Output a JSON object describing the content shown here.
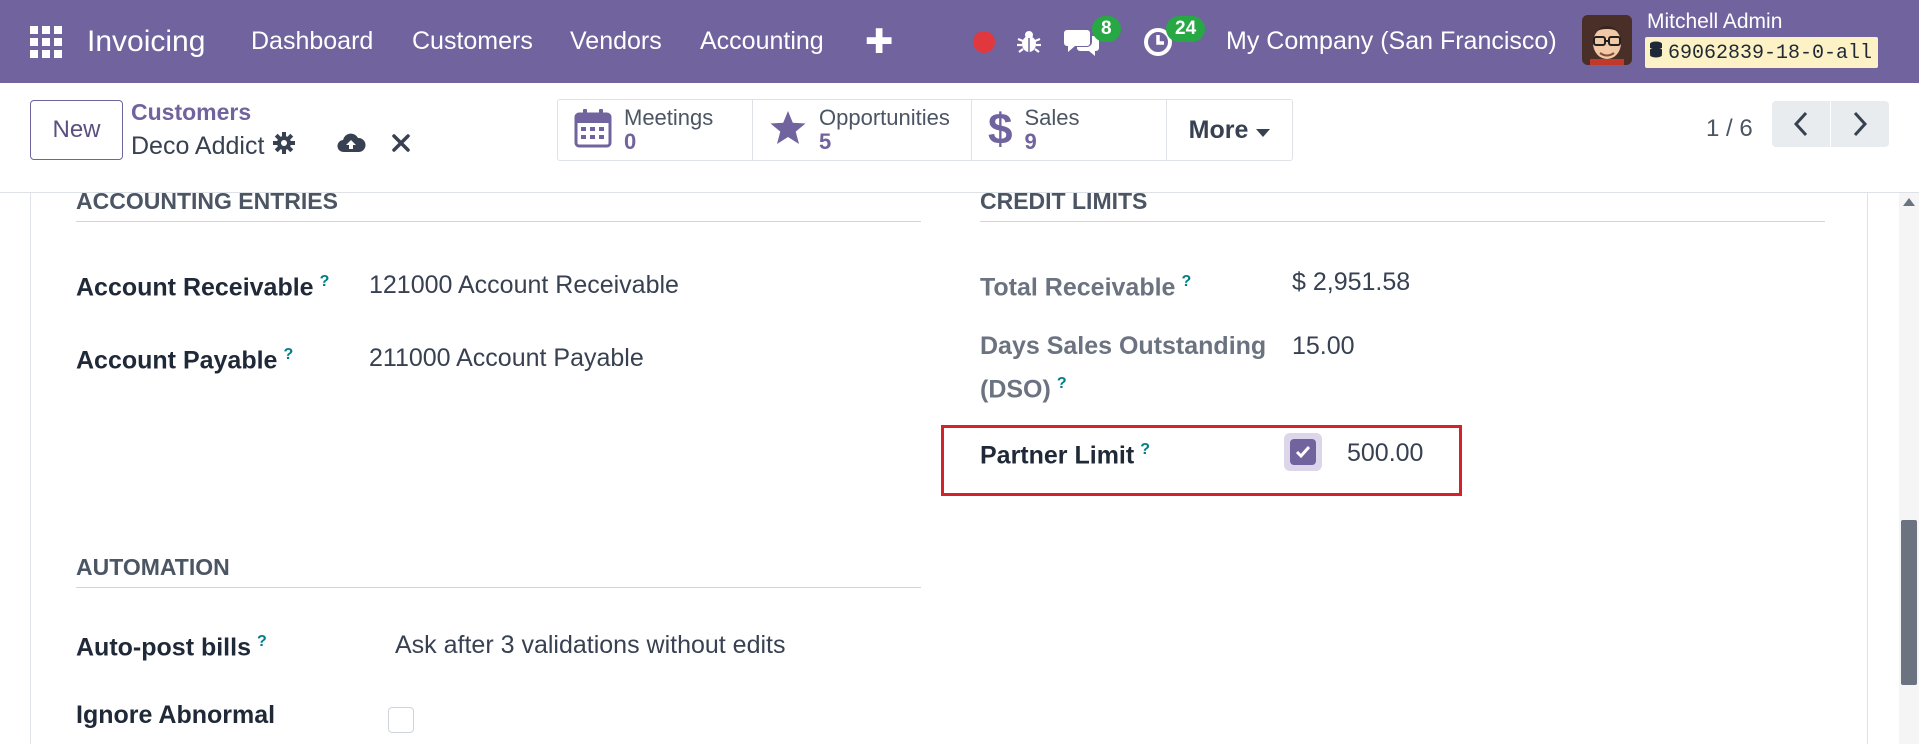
{
  "navbar": {
    "brand": "Invoicing",
    "menu": [
      "Dashboard",
      "Customers",
      "Vendors",
      "Accounting"
    ],
    "chat_count": "8",
    "activity_count": "24",
    "company": "My Company (San Francisco)",
    "user_name": "Mitchell Admin",
    "database": "69062839-18-0-all"
  },
  "control": {
    "new_label": "New",
    "breadcrumb_parent": "Customers",
    "record_name": "Deco Addict",
    "smart_buttons": [
      {
        "label": "Meetings",
        "value": "0",
        "icon": "calendar-icon"
      },
      {
        "label": "Opportunities",
        "value": "5",
        "icon": "star-icon"
      },
      {
        "label": "Sales",
        "value": "9",
        "icon": "dollar-icon"
      }
    ],
    "more_label": "More",
    "pager": "1 / 6"
  },
  "accounting_entries": {
    "title": "ACCOUNTING ENTRIES",
    "receivable_label": "Account Receivable",
    "receivable_value": "121000 Account Receivable",
    "payable_label": "Account Payable",
    "payable_value": "211000 Account Payable"
  },
  "credit_limits": {
    "title": "CREDIT LIMITS",
    "total_receivable_label": "Total Receivable",
    "total_receivable_value": "$ 2,951.58",
    "dso_label_line1": "Days Sales Outstanding",
    "dso_label_line2": "(DSO)",
    "dso_value": "15.00",
    "partner_limit_label": "Partner Limit",
    "partner_limit_checked": true,
    "partner_limit_value": "500.00"
  },
  "automation": {
    "title": "AUTOMATION",
    "auto_post_label": "Auto-post bills",
    "auto_post_value": "Ask after 3 validations without edits",
    "ignore_abnormal_label": "Ignore Abnormal",
    "ignore_abnormal_checked": false
  },
  "help_marker": "?",
  "colors": {
    "navbar": "#71639e",
    "accent": "#71639e",
    "badge": "#28a745",
    "highlight": "#d3222a"
  }
}
